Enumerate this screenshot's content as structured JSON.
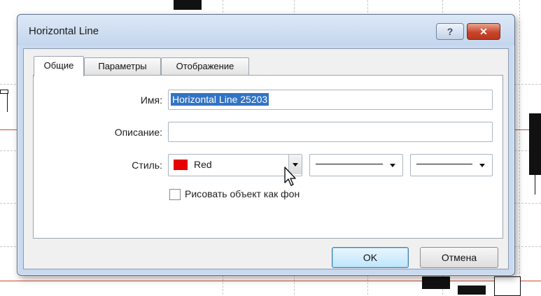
{
  "dialog": {
    "title": "Horizontal Line",
    "help_label": "?",
    "close_label": "✕"
  },
  "tabs": [
    {
      "label": "Общие",
      "active": true
    },
    {
      "label": "Параметры",
      "active": false
    },
    {
      "label": "Отображение",
      "active": false
    }
  ],
  "form": {
    "name_label": "Имя:",
    "name_value": "Horizontal Line 25203",
    "description_label": "Описание:",
    "description_value": "",
    "style_label": "Стиль:",
    "color_value": "Red",
    "color_hex": "#e60000",
    "background_checkbox_label": "Рисовать объект как фон",
    "background_checked": false
  },
  "buttons": {
    "ok_label": "OK",
    "cancel_label": "Отмена"
  },
  "colors": {
    "chart_line": "#d64a2a",
    "selection": "#3173c4"
  }
}
